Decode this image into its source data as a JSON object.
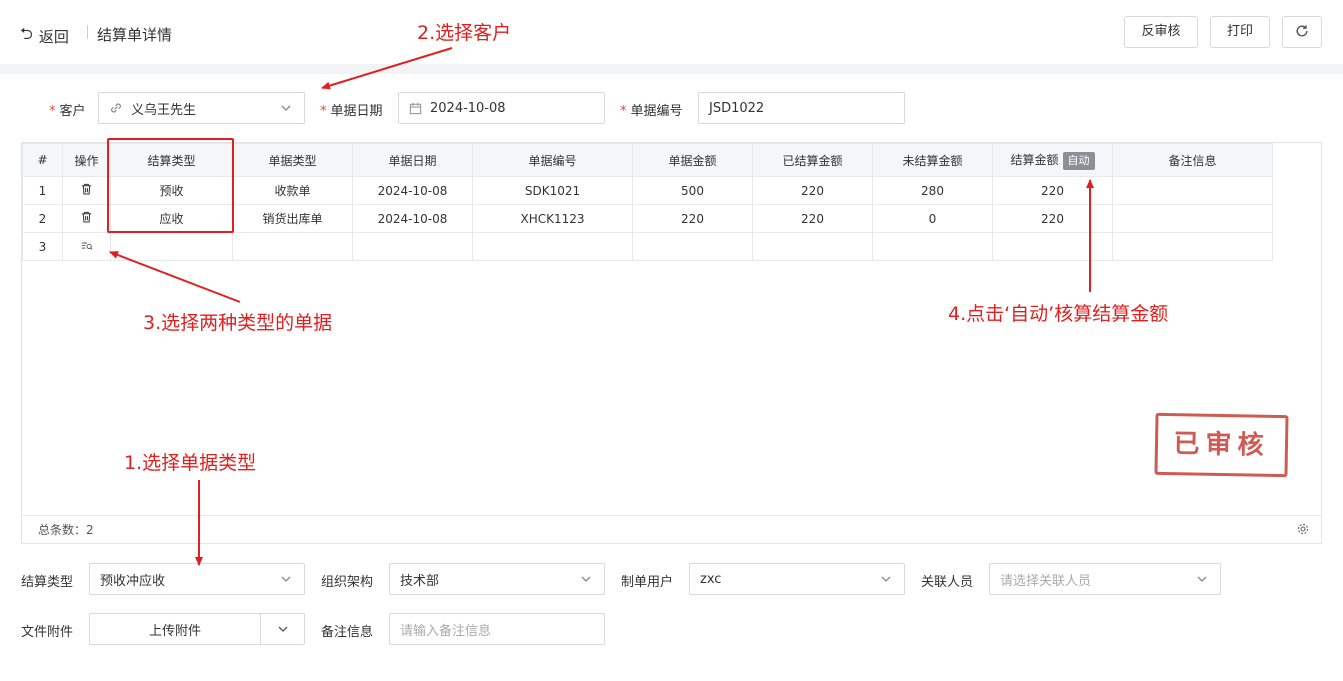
{
  "header": {
    "back_label": "返回",
    "page_title": "结算单详情",
    "unaudit_label": "反审核",
    "print_label": "打印"
  },
  "form_top": {
    "customer": {
      "label": "客户",
      "value": "义乌王先生"
    },
    "doc_date": {
      "label": "单据日期",
      "value": "2024-10-08"
    },
    "doc_no": {
      "label": "单据编号",
      "value": "JSD1022"
    }
  },
  "grid": {
    "columns": [
      "#",
      "操作",
      "结算类型",
      "单据类型",
      "单据日期",
      "单据编号",
      "单据金额",
      "已结算金额",
      "未结算金额",
      "结算金额",
      "备注信息"
    ],
    "auto_badge": "自动",
    "rows": [
      {
        "no": "1",
        "settle_type": "预收",
        "doc_type": "收款单",
        "date": "2024-10-08",
        "doc_no": "SDK1021",
        "amount": "500",
        "settled": "220",
        "unsettled": "280",
        "settle_amount": "220",
        "remark": ""
      },
      {
        "no": "2",
        "settle_type": "应收",
        "doc_type": "销货出库单",
        "date": "2024-10-08",
        "doc_no": "XHCK1123",
        "amount": "220",
        "settled": "220",
        "unsettled": "0",
        "settle_amount": "220",
        "remark": ""
      },
      {
        "no": "3",
        "settle_type": "",
        "doc_type": "",
        "date": "",
        "doc_no": "",
        "amount": "",
        "settled": "",
        "unsettled": "",
        "settle_amount": "",
        "remark": ""
      }
    ],
    "total_label": "总条数：",
    "total_count": "2"
  },
  "stamp_text": "已审核",
  "form_bottom": {
    "settle_type": {
      "label": "结算类型",
      "value": "预收冲应收"
    },
    "org": {
      "label": "组织架构",
      "value": "技术部"
    },
    "creator": {
      "label": "制单用户",
      "value": "zxc"
    },
    "related": {
      "label": "关联人员",
      "placeholder": "请选择关联人员"
    },
    "attachment": {
      "label": "文件附件",
      "button": "上传附件"
    },
    "remark": {
      "label": "备注信息",
      "placeholder": "请输入备注信息"
    }
  },
  "annotations": {
    "a1": "1.选择单据类型",
    "a2": "2.选择客户",
    "a3": "3.选择两种类型的单据",
    "a4": "4.点击‘自动’核算结算金额"
  },
  "colors": {
    "annotation": "#e02020",
    "stamp": "#c9463d",
    "border": "#d9d9d9"
  }
}
